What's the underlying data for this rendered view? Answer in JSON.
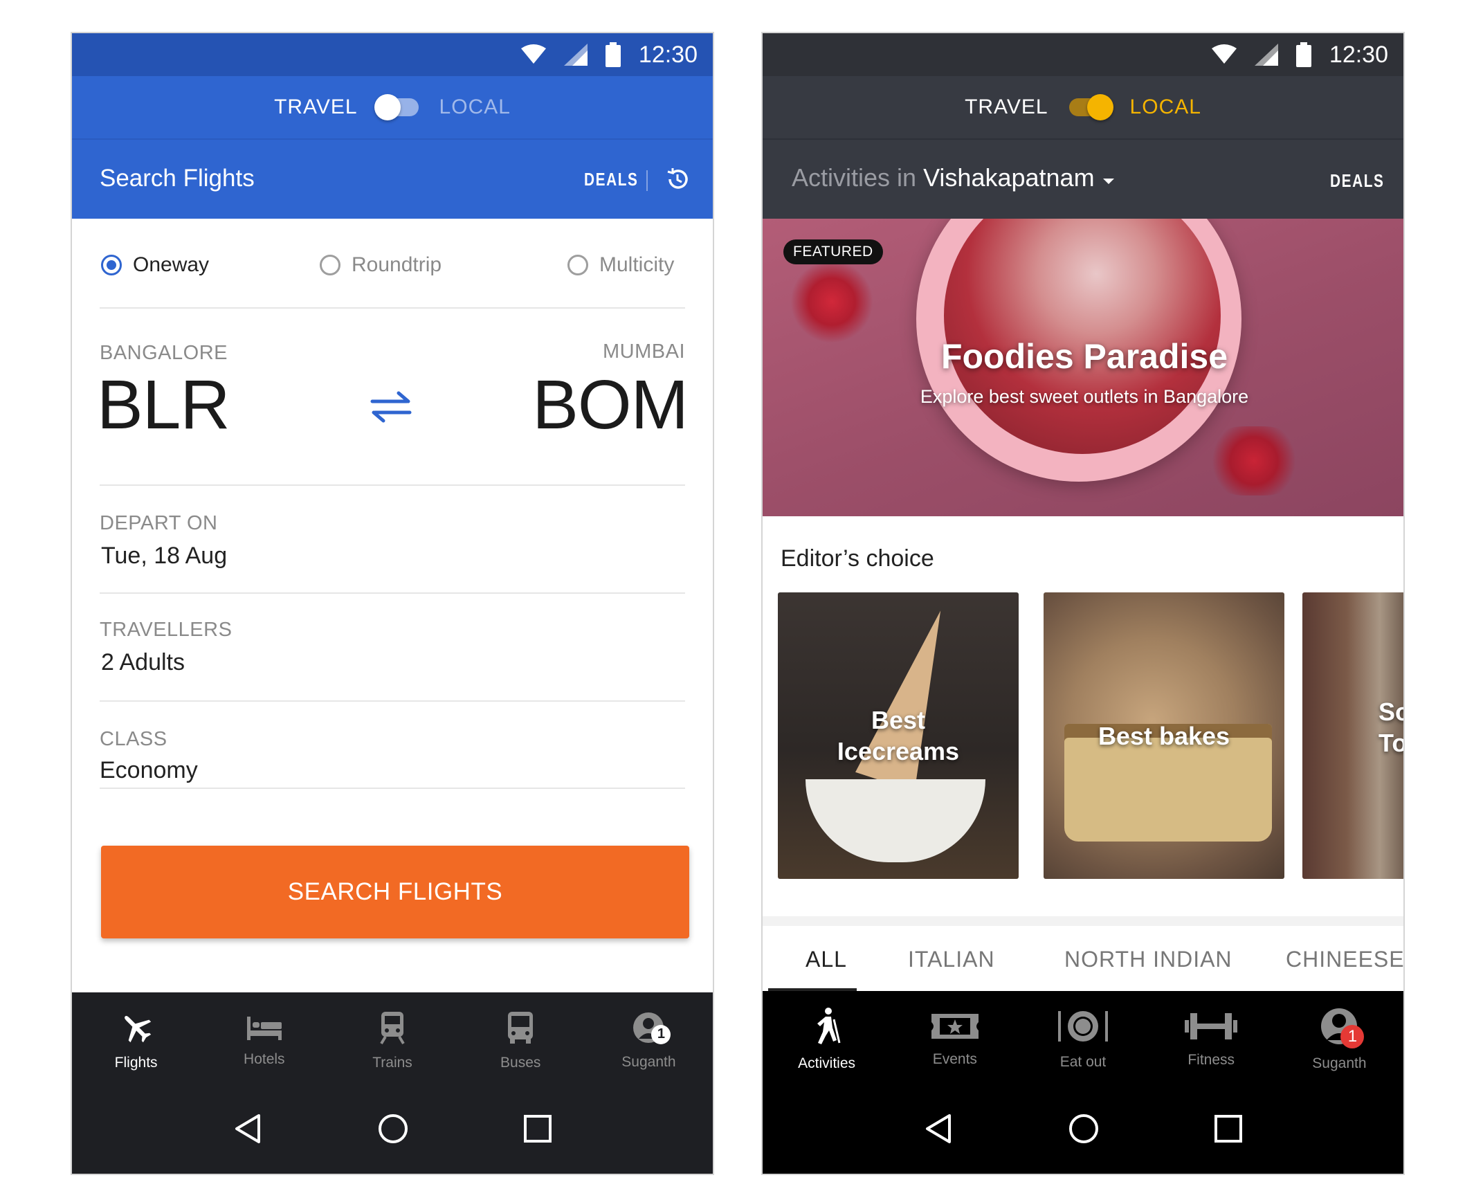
{
  "time": "12:30",
  "left": {
    "toggle": {
      "travel": "TRAVEL",
      "local": "LOCAL"
    },
    "header": {
      "title": "Search Flights",
      "deals": "DEALS"
    },
    "trip_types": [
      "Oneway",
      "Roundtrip",
      "Multicity"
    ],
    "selected_trip": "Oneway",
    "from": {
      "city": "BANGALORE",
      "code": "BLR"
    },
    "to": {
      "city": "MUMBAI",
      "code": "BOM"
    },
    "depart": {
      "label": "DEPART ON",
      "value": "Tue, 18 Aug"
    },
    "travellers": {
      "label": "TRAVELLERS",
      "value": "2 Adults"
    },
    "class": {
      "label": "CLASS",
      "value": "Economy"
    },
    "search_button": "SEARCH FLIGHTS",
    "nav": [
      {
        "label": "Flights",
        "icon": "airplane-icon",
        "active": true
      },
      {
        "label": "Hotels",
        "icon": "bed-icon",
        "active": false
      },
      {
        "label": "Trains",
        "icon": "train-icon",
        "active": false
      },
      {
        "label": "Buses",
        "icon": "bus-icon",
        "active": false
      },
      {
        "label": "Suganth",
        "icon": "profile-icon",
        "active": false,
        "badge": "1"
      }
    ],
    "colors": {
      "primary": "#2f65d0",
      "status": "#2553b3",
      "accent": "#f26a24"
    }
  },
  "right": {
    "toggle": {
      "travel": "TRAVEL",
      "local": "LOCAL"
    },
    "header": {
      "prefix": "Activities in",
      "city": "Vishakapatnam",
      "deals": "DEALS"
    },
    "featured": {
      "badge": "FEATURED",
      "title": "Foodies Paradise",
      "subtitle": "Explore best sweet outlets in Bangalore"
    },
    "editors_choice": "Editor’s choice",
    "cards": [
      {
        "line1": "Best",
        "line2": "Icecreams"
      },
      {
        "line1": "Best bakes",
        "line2": ""
      },
      {
        "line1": "So",
        "line2": "To"
      }
    ],
    "tabs": [
      "ALL",
      "ITALIAN",
      "NORTH INDIAN",
      "CHINEESE"
    ],
    "active_tab": "ALL",
    "nav": [
      {
        "label": "Activities",
        "icon": "hiking-icon",
        "active": true
      },
      {
        "label": "Events",
        "icon": "ticket-icon",
        "active": false
      },
      {
        "label": "Eat out",
        "icon": "plate-icon",
        "active": false
      },
      {
        "label": "Fitness",
        "icon": "dumbbell-icon",
        "active": false
      },
      {
        "label": "Suganth",
        "icon": "profile-icon",
        "active": false,
        "badge": "1"
      }
    ],
    "colors": {
      "header": "#373a42",
      "status": "#2f3137",
      "accent": "#f5b400",
      "badge": "#e53935"
    }
  }
}
